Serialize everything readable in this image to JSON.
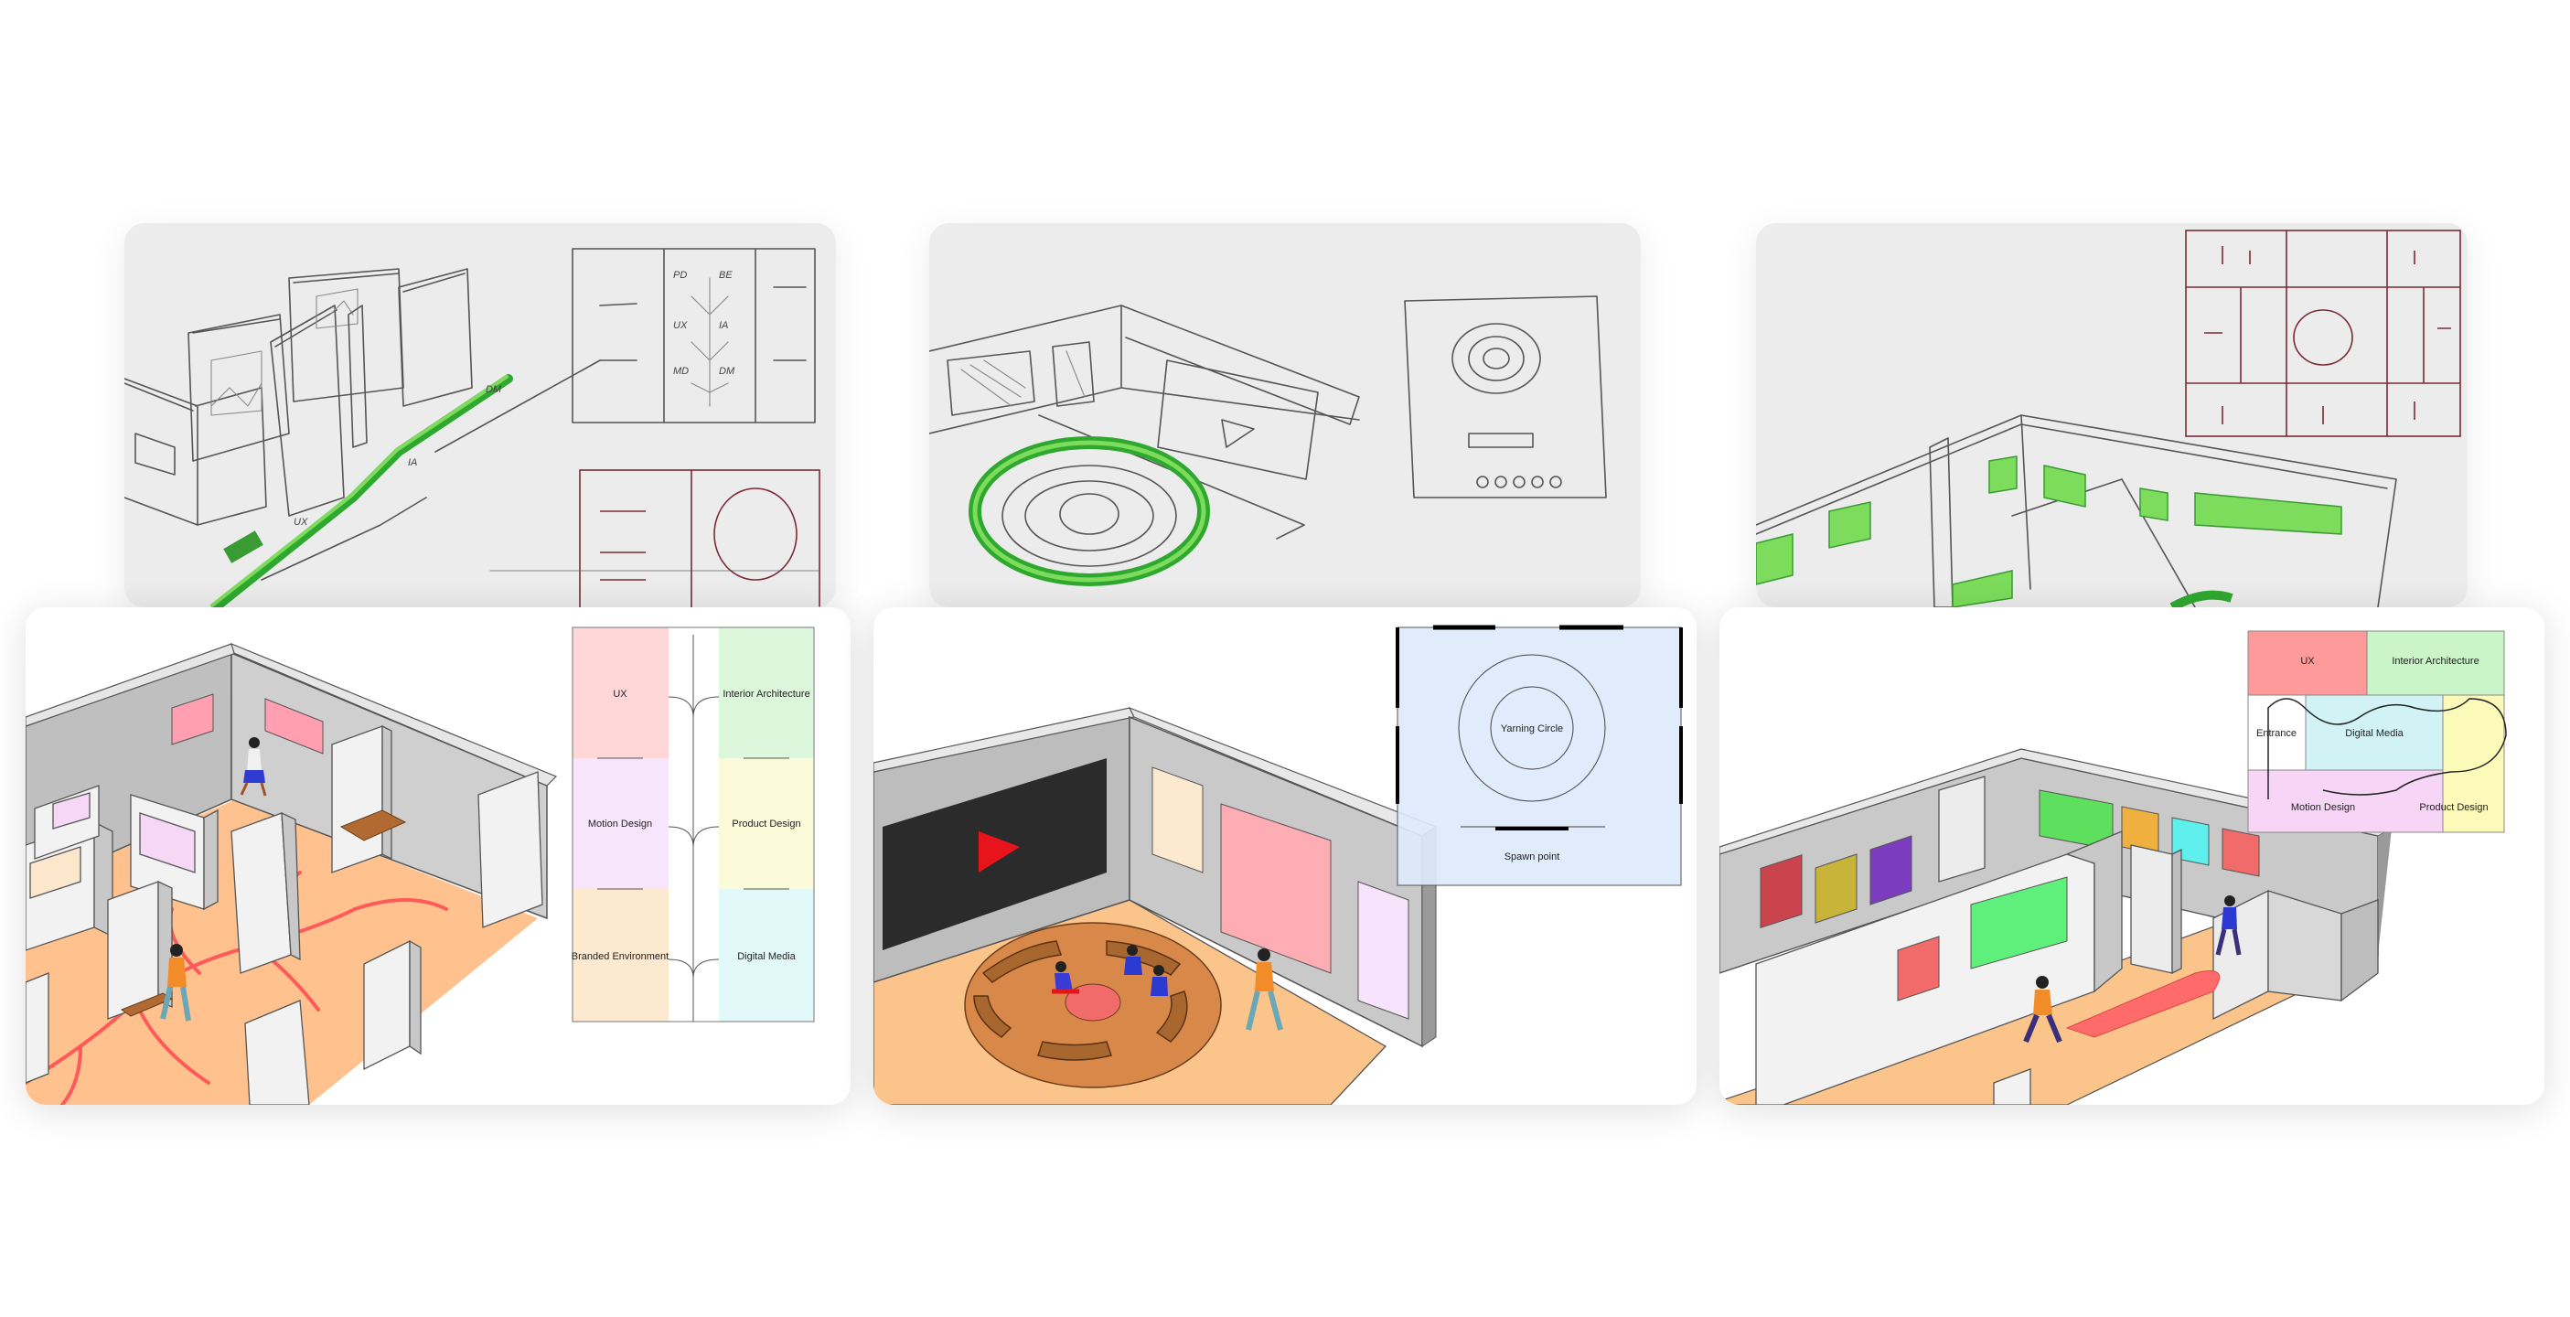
{
  "sketches": [
    {
      "name": "sketch-1",
      "labels": [
        "PD",
        "BE",
        "UX",
        "IA",
        "MD",
        "DM"
      ]
    },
    {
      "name": "sketch-2"
    },
    {
      "name": "sketch-3"
    }
  ],
  "illustrations": {
    "overview": {
      "zones": [
        "UX",
        "Interior Architecture",
        "Motion Design",
        "Product Design",
        "Branded Environment",
        "Digital Media"
      ],
      "colors": {
        "ux": "#ffd7d7",
        "ia": "#dcf7dc",
        "md": "#f7e6fb",
        "pd": "#fbfbd9",
        "be": "#fde9cf",
        "dm": "#e3f8f8",
        "floor": "#ffc28e",
        "path": "#ff5a5a"
      }
    },
    "yarning": {
      "circle_label": "Yarning Circle",
      "spawn_label": "Spawn point",
      "colors": {
        "map": "#dde9fc",
        "screen": "#2b2b2b",
        "play": "#e8141b",
        "floor": "#fbc48a",
        "bench": "#a8672e"
      }
    },
    "layout": {
      "zones": {
        "ux": "UX",
        "ia": "Interior Architecture",
        "entrance": "Entrance",
        "dm": "Digital Media",
        "md": "Motion Design",
        "pd": "Product Design"
      },
      "colors": {
        "ux": "#ff9a9a",
        "ia": "#c9f5c9",
        "dm": "#d2f3f6",
        "md": "#f6d5f6",
        "pd": "#fbfab8",
        "path": "#ff6b6b"
      }
    }
  }
}
